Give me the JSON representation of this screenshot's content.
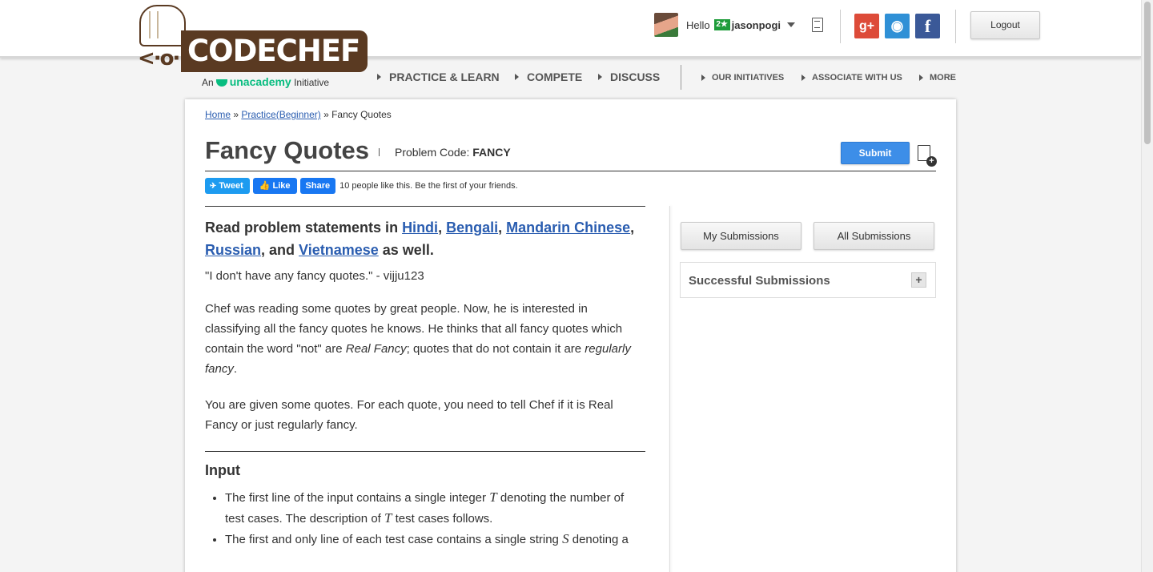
{
  "logo": {
    "text": "CODECHEF",
    "face": "<·o·>",
    "sub_prefix": "An",
    "sub_brand": "unacademy",
    "sub_suffix": "Initiative"
  },
  "user": {
    "greeting": "Hello",
    "stars": "2★",
    "username": "jasonpogi"
  },
  "social": {
    "google": "g+",
    "github": "◉",
    "facebook": "f"
  },
  "header": {
    "logout_label": "Logout"
  },
  "nav": {
    "practice": "PRACTICE & LEARN",
    "compete": "COMPETE",
    "discuss": "DISCUSS",
    "initiatives": "OUR INITIATIVES",
    "associate": "ASSOCIATE WITH US",
    "more": "MORE"
  },
  "breadcrumb": {
    "home": "Home",
    "sep1": " » ",
    "practice": "Practice(Beginner)",
    "sep2": " » ",
    "current": "Fancy Quotes"
  },
  "problem": {
    "title": "Fancy Quotes",
    "code_label": "Problem Code: ",
    "code": "FANCY",
    "submit_label": "Submit"
  },
  "share": {
    "tweet": "Tweet",
    "tweet_icon": "✈",
    "like": "Like",
    "share": "Share",
    "like_text": "10 people like this. Be the first of your friends."
  },
  "statement": {
    "read_prefix": "Read problem statements in ",
    "lang_hindi": "Hindi",
    "c1": ", ",
    "lang_bengali": "Bengali",
    "c2": ", ",
    "lang_mandarin": "Mandarin Chinese",
    "c3": ",",
    "lang_russian": "Russian",
    "and_text": ", and ",
    "lang_vietnamese": "Vietnamese",
    "as_well": " as well.",
    "quote": "\"I don't have any fancy quotes.\" - vijju123",
    "p1_a": "Chef was reading some quotes by great people. Now, he is interested in classifying all the fancy quotes he knows. He thinks that all fancy quotes which contain the word \"not\" are ",
    "p1_real": "Real Fancy",
    "p1_b": "; quotes that do not contain it are ",
    "p1_reg": "regularly fancy",
    "p1_c": ".",
    "p2": "You are given some quotes. For each quote, you need to tell Chef if it is Real Fancy or just regularly fancy.",
    "input_heading": "Input",
    "li1_a": "The first line of the input contains a single integer ",
    "var_t": "T",
    "li1_b": " denoting the number of test cases. The description of ",
    "li1_c": " test cases follows.",
    "li2_a": "The first and only line of each test case contains a single string ",
    "var_s": "S",
    "li2_b": " denoting a"
  },
  "sidebar": {
    "my_submissions": "My Submissions",
    "all_submissions": "All Submissions",
    "successful_title": "Successful Submissions",
    "expand": "+"
  }
}
